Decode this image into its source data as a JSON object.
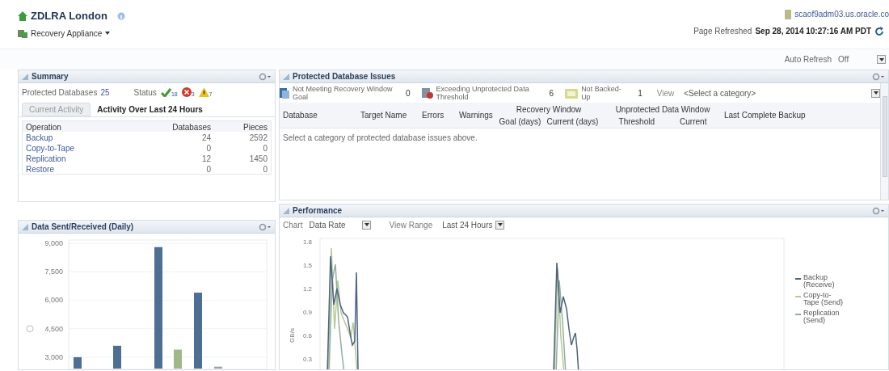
{
  "header": {
    "title": "ZDLRA London",
    "menu": "Recovery Appliance",
    "user_host": "scaof9adm03.us.oracle.co",
    "refreshed_label": "Page Refreshed",
    "refreshed_time": "Sep 28, 2014 10:27:16 AM PDT"
  },
  "auto_refresh": {
    "label": "Auto Refresh",
    "value": "Off"
  },
  "summary": {
    "title": "Summary",
    "protected_label": "Protected Databases",
    "protected_count": "25",
    "status_label": "Status",
    "status": [
      {
        "kind": "ok",
        "count": "18"
      },
      {
        "kind": "error",
        "count": "3"
      },
      {
        "kind": "warning",
        "count": "7"
      }
    ],
    "tabs": [
      {
        "label": "Current Activity",
        "selected": false
      },
      {
        "label": "Activity Over Last 24 Hours",
        "selected": true
      }
    ],
    "columns": [
      "Operation",
      "Databases",
      "Pieces"
    ],
    "rows": [
      {
        "operation": "Backup",
        "databases": "24",
        "pieces": "2592"
      },
      {
        "operation": "Copy-to-Tape",
        "databases": "0",
        "pieces": "0"
      },
      {
        "operation": "Replication",
        "databases": "12",
        "pieces": "1450"
      },
      {
        "operation": "Restore",
        "databases": "0",
        "pieces": "0"
      }
    ]
  },
  "data_sent": {
    "title": "Data Sent/Received (Daily)",
    "chart_data": {
      "type": "bar",
      "grid": true,
      "ylim": [
        2400,
        9000
      ],
      "yticks": [
        {
          "value": 3000,
          "label": "3,000"
        },
        {
          "value": 4500,
          "label": "4,500"
        },
        {
          "value": 6000,
          "label": "6,000"
        },
        {
          "value": 7500,
          "label": "7,500"
        },
        {
          "value": 9000,
          "label": "9,000"
        }
      ],
      "values": [
        3000,
        3600,
        8800,
        3400,
        6400,
        2500
      ],
      "colors": [
        "#4d6f93",
        "#4d6f93",
        "#4d6f93",
        "#9fb78a",
        "#4d6f93",
        "#9aa4ad"
      ]
    }
  },
  "issues": {
    "title": "Protected Database Issues",
    "categories": [
      {
        "kind": "recovery",
        "label": "Not Meeting Recovery Window Goal",
        "count": "0"
      },
      {
        "kind": "unprotected",
        "label": "Exceeding Unprotected Data Threshold",
        "count": "6"
      },
      {
        "kind": "backup",
        "label": "Not Backed-Up",
        "count": "1"
      }
    ],
    "view_label": "View",
    "view_value": "<Select a category>",
    "columns": [
      {
        "label": "Database"
      },
      {
        "label": "Target Name"
      },
      {
        "label": "Errors"
      },
      {
        "label": "Warnings"
      },
      {
        "label": "Recovery Window",
        "children": [
          "Goal (days)",
          "Current (days)"
        ]
      },
      {
        "label": "Unprotected Data Window",
        "children": [
          "Threshold",
          "Current"
        ]
      },
      {
        "label": "Last Complete Backup"
      }
    ],
    "empty_message": "Select a category of protected database issues above."
  },
  "performance": {
    "title": "Performance",
    "chart_label": "Chart",
    "chart_value": "Data Rate",
    "range_label": "View Range",
    "range_value": "Last 24 Hours",
    "y_axis": "GB/s",
    "y_ticks": [
      "1.8",
      "1.5",
      "1.2",
      "0.9",
      "0.6",
      "0.3"
    ],
    "legend": [
      {
        "label": "Backup (Receive)",
        "color": "#4d6280"
      },
      {
        "label": "Copy-to-Tape (Send)",
        "color": "#b6c98f"
      },
      {
        "label": "Replication (Send)",
        "color": "#8fb0a0"
      }
    ]
  }
}
